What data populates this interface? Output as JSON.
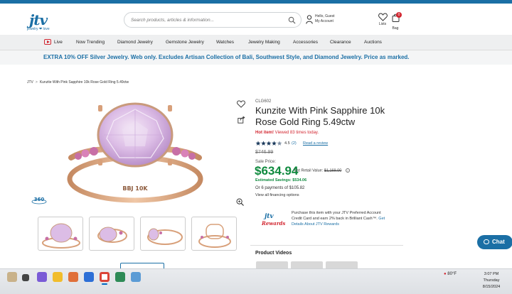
{
  "header": {
    "logo_text": "jtv",
    "logo_tagline": "jewelry ❤ love",
    "search_placeholder": "Search products, articles & information...",
    "account_line1": "Hello, Guest",
    "account_line2": "My Account",
    "lists_label": "Lists",
    "bag_label": "Bag",
    "bag_count": "0"
  },
  "nav": {
    "items": [
      "Live",
      "Now Trending",
      "Diamond Jewelry",
      "Gemstone Jewelry",
      "Watches",
      "Jewelry Making",
      "Accessories",
      "Clearance",
      "Auctions"
    ]
  },
  "promo": {
    "text": "EXTRA 10% OFF Silver Jewelry. Web only. Excludes Artisan Collection of Bali, Southwest Style, and Diamond Jewelry. Price as marked."
  },
  "breadcrumb": {
    "root": "JTV",
    "separator": ">",
    "current": "Kunzite With Pink Sapphire 10k Rose Gold Ring 5.49ctw"
  },
  "gallery": {
    "badge_360": "360",
    "ring_engraving": "BBJ 10K",
    "thumbnails": 4
  },
  "product": {
    "sku": "CLG602",
    "title": "Kunzite With Pink Sapphire 10k Rose Gold Ring 5.49ctw",
    "hot_label": "Hot item!",
    "hot_views": "Viewed 83 times today.",
    "rating_value": "4.5",
    "rating_stars": 4.5,
    "review_count": "(2)",
    "review_link": "Read a review",
    "original_price": "$746.99",
    "sale_label": "Sale Price:",
    "sale_price": "$634.94",
    "retail_label": "Est Retail Value:",
    "retail_value": "$1,169.00",
    "info_glyph": "?",
    "savings": "Estimated Savings: $534.06",
    "payments": "Or 6 payments of $105.82",
    "financing": "View all financing options"
  },
  "rewards": {
    "logo_line1": "jtv",
    "logo_line2": "Rewards",
    "text": "Purchase this item with your JTV Preferred Account Credit Card and earn 2% back in Brilliant Cash™.",
    "link": "Get Details About JTV Rewards"
  },
  "videos": {
    "label": "Product Videos"
  },
  "chat": {
    "label": "Chat"
  },
  "taskbar": {
    "temperature": "80°F",
    "time": "3:07 PM",
    "day": "Thursday",
    "date": "8/15/2024"
  },
  "colors": {
    "brand_blue": "#1b6fa5",
    "price_green": "#0f8a3e",
    "hot_red": "#d22630",
    "rose_gold": "#d8a07a",
    "kunzite": "#e2c6ec"
  }
}
